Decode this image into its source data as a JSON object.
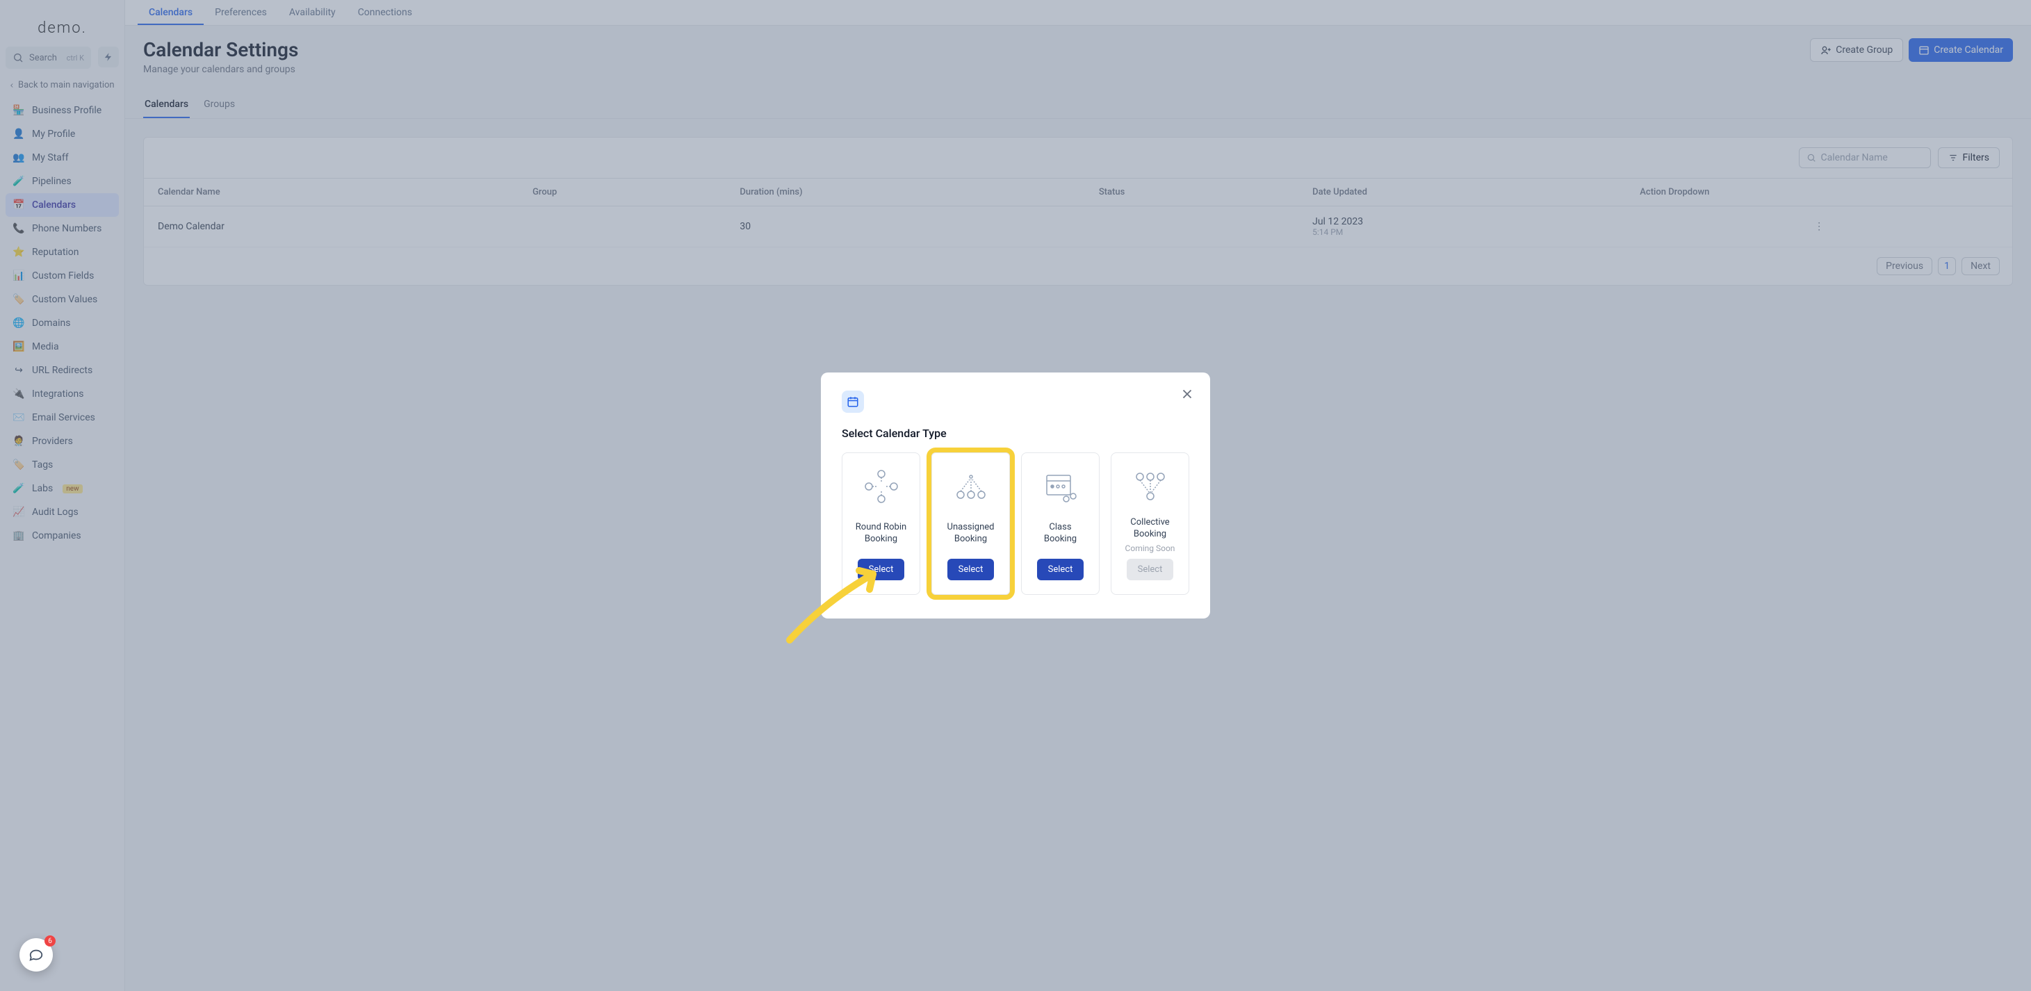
{
  "logo": "demo.",
  "search": {
    "label": "Search",
    "shortcut": "ctrl K"
  },
  "back_link": "Back to main navigation",
  "sidebar_items": [
    {
      "icon": "🏪",
      "label": "Business Profile"
    },
    {
      "icon": "👤",
      "label": "My Profile"
    },
    {
      "icon": "👥",
      "label": "My Staff"
    },
    {
      "icon": "🧪",
      "label": "Pipelines"
    },
    {
      "icon": "📅",
      "label": "Calendars",
      "active": true
    },
    {
      "icon": "📞",
      "label": "Phone Numbers"
    },
    {
      "icon": "⭐",
      "label": "Reputation"
    },
    {
      "icon": "📊",
      "label": "Custom Fields"
    },
    {
      "icon": "🏷️",
      "label": "Custom Values"
    },
    {
      "icon": "🌐",
      "label": "Domains"
    },
    {
      "icon": "🖼️",
      "label": "Media"
    },
    {
      "icon": "↪",
      "label": "URL Redirects"
    },
    {
      "icon": "🔌",
      "label": "Integrations"
    },
    {
      "icon": "✉️",
      "label": "Email Services"
    },
    {
      "icon": "🧑‍⚕️",
      "label": "Providers"
    },
    {
      "icon": "🏷️",
      "label": "Tags"
    },
    {
      "icon": "🧪",
      "label": "Labs",
      "badge": "new"
    },
    {
      "icon": "📈",
      "label": "Audit Logs"
    },
    {
      "icon": "🏢",
      "label": "Companies"
    }
  ],
  "top_tabs": [
    "Calendars",
    "Preferences",
    "Availability",
    "Connections"
  ],
  "top_tab_active": 0,
  "page_title": "Calendar Settings",
  "page_subtitle": "Manage your calendars and groups",
  "head_actions": {
    "create_group": "Create Group",
    "create_calendar": "Create Calendar"
  },
  "sub_tabs": [
    "Calendars",
    "Groups"
  ],
  "sub_tab_active": 0,
  "search_placeholder": "Calendar Name",
  "filters_label": "Filters",
  "columns": [
    "Calendar Name",
    "Group",
    "Duration (mins)",
    "Status",
    "Date Updated",
    "Action Dropdown"
  ],
  "rows": [
    {
      "name": "Demo Calendar",
      "group": "",
      "duration": "30",
      "status": "",
      "updated_date": "Jul 12 2023",
      "updated_time": "5:14 PM"
    }
  ],
  "pager": {
    "prev": "Previous",
    "page": "1",
    "next": "Next"
  },
  "modal": {
    "title": "Select Calendar Type",
    "types": [
      {
        "name": "Round Robin\nBooking",
        "button": "Select"
      },
      {
        "name": "Unassigned\nBooking",
        "button": "Select",
        "highlight": true
      },
      {
        "name": "Class\nBooking",
        "button": "Select"
      },
      {
        "name": "Collective\nBooking",
        "soon": "Coming Soon",
        "button": "Select",
        "disabled": true
      }
    ]
  },
  "chat_badge": "6"
}
